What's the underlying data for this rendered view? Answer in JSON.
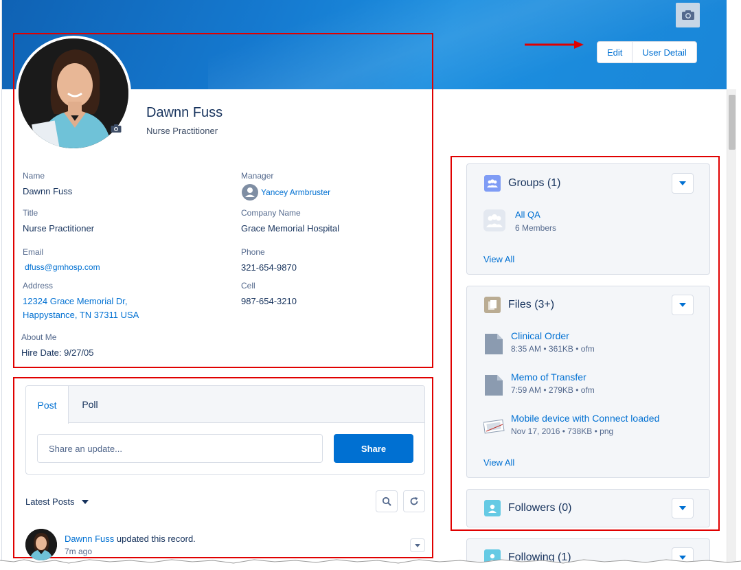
{
  "header": {
    "edit_label": "Edit",
    "user_detail_label": "User Detail"
  },
  "profile": {
    "name": "Dawnn Fuss",
    "title": "Nurse Practitioner"
  },
  "details": {
    "name_label": "Name",
    "name_value": "Dawnn Fuss",
    "manager_label": "Manager",
    "manager_value": "Yancey Armbruster",
    "title_label": "Title",
    "title_value": "Nurse Practitioner",
    "company_label": "Company Name",
    "company_value": "Grace Memorial Hospital",
    "email_label": "Email",
    "email_value": "dfuss@gmhosp.com",
    "phone_label": "Phone",
    "phone_value": "321-654-9870",
    "address_label": "Address",
    "address_line1": "12324 Grace Memorial Dr,",
    "address_line2": "Happystance, TN 37311 USA",
    "cell_label": "Cell",
    "cell_value": "987-654-3210",
    "about_label": "About Me",
    "about_value": "Hire Date: 9/27/05"
  },
  "publisher": {
    "tab_post": "Post",
    "tab_poll": "Poll",
    "placeholder": "Share an update...",
    "share_label": "Share"
  },
  "feed": {
    "sort_label": "Latest Posts",
    "post_author": "Dawnn Fuss",
    "post_action": "updated this record.",
    "post_time": "7m ago"
  },
  "groups": {
    "title": "Groups (1)",
    "item_name": "All QA",
    "item_members": "6 Members",
    "view_all": "View All"
  },
  "files": {
    "title": "Files (3+)",
    "items": [
      {
        "name": "Clinical Order",
        "meta": "8:35 AM • 361KB • ofm"
      },
      {
        "name": "Memo of Transfer",
        "meta": "7:59 AM • 279KB • ofm"
      },
      {
        "name": "Mobile device with Connect loaded",
        "meta": "Nov 17, 2016 • 738KB • png"
      }
    ],
    "view_all": "View All"
  },
  "followers": {
    "title": "Followers (0)"
  },
  "following": {
    "title": "Following (1)"
  },
  "colors": {
    "brand": "#0070d2",
    "highlight_box": "#e00000",
    "groups_icon": "#7f9cf5",
    "files_icon": "#baac93",
    "people_icon": "#65cae4"
  }
}
